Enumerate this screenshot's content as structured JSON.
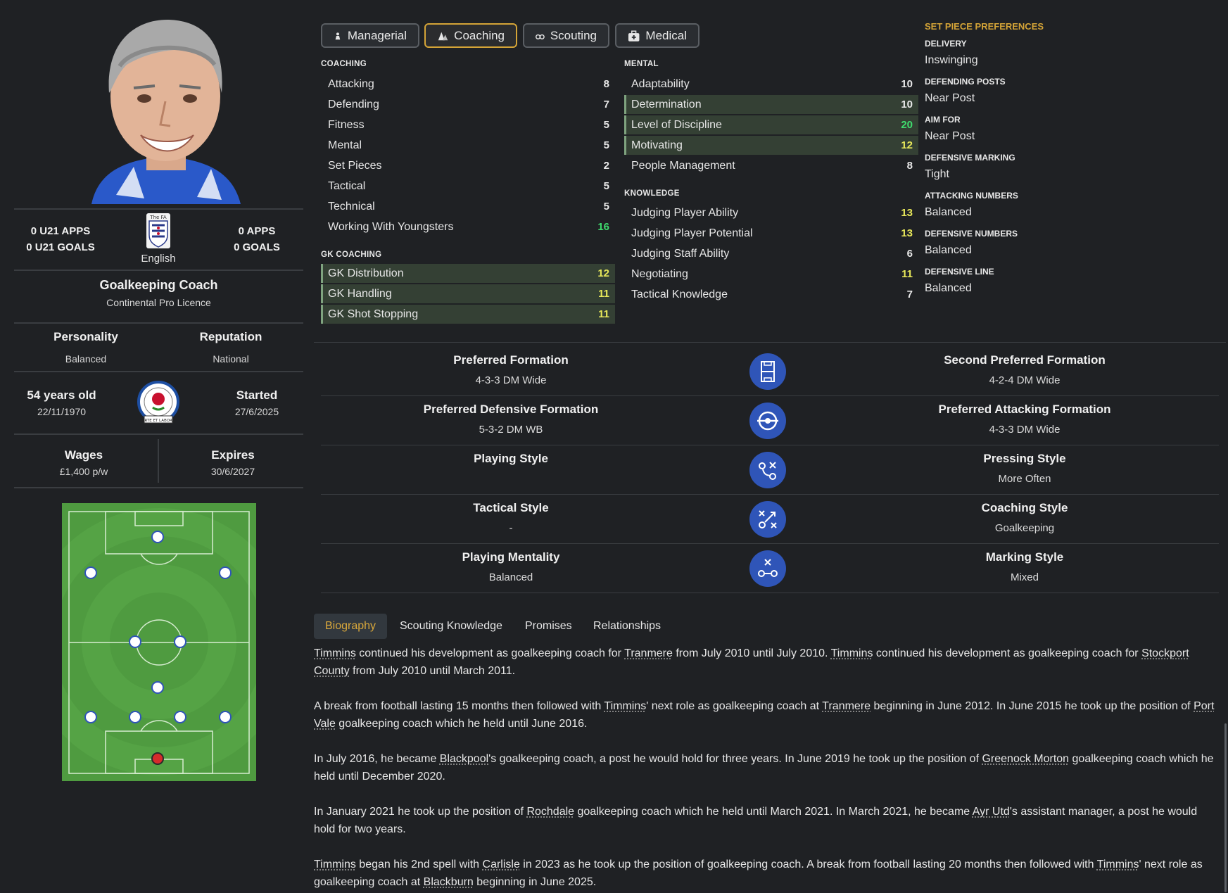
{
  "profile": {
    "u21_apps": "0 U21 APPS",
    "u21_goals": "0 U21 GOALS",
    "apps": "0 APPS",
    "goals": "0 GOALS",
    "nationality": "English",
    "role": "Goalkeeping Coach",
    "licence": "Continental Pro Licence",
    "personality_label": "Personality",
    "personality_value": "Balanced",
    "reputation_label": "Reputation",
    "reputation_value": "National",
    "age": "54 years old",
    "dob": "22/11/1970",
    "started_label": "Started",
    "started_value": "27/6/2025",
    "wages_label": "Wages",
    "wages_value": "£1,400 p/w",
    "expires_label": "Expires",
    "expires_value": "30/6/2027",
    "fa_logo_text": "The FA",
    "club_logo_text": "ARTE ET LABORE"
  },
  "tabs": [
    {
      "label": "Managerial",
      "icon": "person-icon"
    },
    {
      "label": "Coaching",
      "icon": "cones-icon"
    },
    {
      "label": "Scouting",
      "icon": "binoculars-icon"
    },
    {
      "label": "Medical",
      "icon": "medical-kit-icon"
    }
  ],
  "coaching": {
    "title": "COACHING",
    "items": [
      {
        "label": "Attacking",
        "value": "8"
      },
      {
        "label": "Defending",
        "value": "7"
      },
      {
        "label": "Fitness",
        "value": "5"
      },
      {
        "label": "Mental",
        "value": "5"
      },
      {
        "label": "Set Pieces",
        "value": "2"
      },
      {
        "label": "Tactical",
        "value": "5"
      },
      {
        "label": "Technical",
        "value": "5"
      },
      {
        "label": "Working With Youngsters",
        "value": "16"
      }
    ]
  },
  "gk_coaching": {
    "title": "GK COACHING",
    "items": [
      {
        "label": "GK Distribution",
        "value": "12"
      },
      {
        "label": "GK Handling",
        "value": "11"
      },
      {
        "label": "GK Shot Stopping",
        "value": "11"
      }
    ]
  },
  "mental": {
    "title": "MENTAL",
    "items": [
      {
        "label": "Adaptability",
        "value": "10"
      },
      {
        "label": "Determination",
        "value": "10"
      },
      {
        "label": "Level of Discipline",
        "value": "20"
      },
      {
        "label": "Motivating",
        "value": "12"
      },
      {
        "label": "People Management",
        "value": "8"
      }
    ]
  },
  "knowledge": {
    "title": "KNOWLEDGE",
    "items": [
      {
        "label": "Judging Player Ability",
        "value": "13"
      },
      {
        "label": "Judging Player Potential",
        "value": "13"
      },
      {
        "label": "Judging Staff Ability",
        "value": "6"
      },
      {
        "label": "Negotiating",
        "value": "11"
      },
      {
        "label": "Tactical Knowledge",
        "value": "7"
      }
    ]
  },
  "set_pieces": {
    "title": "SET PIECE PREFERENCES",
    "items": [
      {
        "label": "DELIVERY",
        "value": "Inswinging"
      },
      {
        "label": "DEFENDING POSTS",
        "value": "Near Post"
      },
      {
        "label": "AIM FOR",
        "value": "Near Post"
      },
      {
        "label": "DEFENSIVE MARKING",
        "value": "Tight"
      },
      {
        "label": "ATTACKING NUMBERS",
        "value": "Balanced"
      },
      {
        "label": "DEFENSIVE NUMBERS",
        "value": "Balanced"
      },
      {
        "label": "DEFENSIVE LINE",
        "value": "Balanced"
      }
    ]
  },
  "formations": [
    {
      "left_label": "Preferred Formation",
      "left_value": "4-3-3 DM Wide",
      "icon": "pitch-icon",
      "right_label": "Second Preferred Formation",
      "right_value": "4-2-4 DM Wide"
    },
    {
      "left_label": "Preferred Defensive Formation",
      "left_value": "5-3-2 DM WB",
      "icon": "target-icon",
      "right_label": "Preferred Attacking Formation",
      "right_value": "4-3-3 DM Wide"
    },
    {
      "left_label": "Playing Style",
      "left_value": "",
      "icon": "play-diagram-icon",
      "right_label": "Pressing Style",
      "right_value": "More Often"
    },
    {
      "left_label": "Tactical Style",
      "left_value": "-",
      "icon": "tactics-icon",
      "right_label": "Coaching Style",
      "right_value": "Goalkeeping"
    },
    {
      "left_label": "Playing Mentality",
      "left_value": "Balanced",
      "icon": "mentality-icon",
      "right_label": "Marking Style",
      "right_value": "Mixed"
    }
  ],
  "bottom_tabs": [
    "Biography",
    "Scouting Knowledge",
    "Promises",
    "Relationships"
  ],
  "biography": [
    [
      {
        "t": "Timmins",
        "link": true
      },
      {
        "t": " continued his development as goalkeeping coach for "
      },
      {
        "t": "Tranmere",
        "link": true
      },
      {
        "t": " from July 2010 until July 2010. "
      },
      {
        "t": "Timmins",
        "link": true
      },
      {
        "t": " continued his development as goalkeeping coach for "
      },
      {
        "t": "Stockport County",
        "link": true
      },
      {
        "t": " from July 2010 until March 2011."
      }
    ],
    [
      {
        "t": "A break from football lasting 15 months then followed with "
      },
      {
        "t": "Timmins",
        "link": true
      },
      {
        "t": "' next role as goalkeeping coach at "
      },
      {
        "t": "Tranmere",
        "link": true
      },
      {
        "t": " beginning in June 2012. In June 2015 he took up the position of "
      },
      {
        "t": "Port Vale",
        "link": true
      },
      {
        "t": " goalkeeping coach which he held until June 2016."
      }
    ],
    [
      {
        "t": "In July 2016, he became "
      },
      {
        "t": "Blackpool",
        "link": true
      },
      {
        "t": "'s goalkeeping coach, a post he would hold for three years. In June 2019 he took up the position of "
      },
      {
        "t": "Greenock Morton",
        "link": true
      },
      {
        "t": " goalkeeping coach which he held until December 2020."
      }
    ],
    [
      {
        "t": "In January 2021 he took up the position of "
      },
      {
        "t": "Rochdale",
        "link": true
      },
      {
        "t": " goalkeeping coach which he held until March 2021. In March 2021, he became "
      },
      {
        "t": "Ayr Utd",
        "link": true
      },
      {
        "t": "'s assistant manager, a post he would hold for two years."
      }
    ],
    [
      {
        "t": "Timmins",
        "link": true
      },
      {
        "t": " began his 2nd spell with "
      },
      {
        "t": "Carlisle",
        "link": true
      },
      {
        "t": " in 2023 as he took up the position of goalkeeping coach. A break from football lasting 20 months then followed with "
      },
      {
        "t": "Timmins",
        "link": true
      },
      {
        "t": "' next role as goalkeeping coach at "
      },
      {
        "t": "Blackburn",
        "link": true
      },
      {
        "t": " beginning in June 2025."
      }
    ]
  ],
  "colors": {
    "background": "#1f2124",
    "accent_gold": "#d4a437",
    "value_yellow": "#e8e85a",
    "value_green": "#3fdc6e",
    "highlight_row": "#344034",
    "formation_icon": "#2f55b8",
    "pitch": "#4f9b40"
  }
}
